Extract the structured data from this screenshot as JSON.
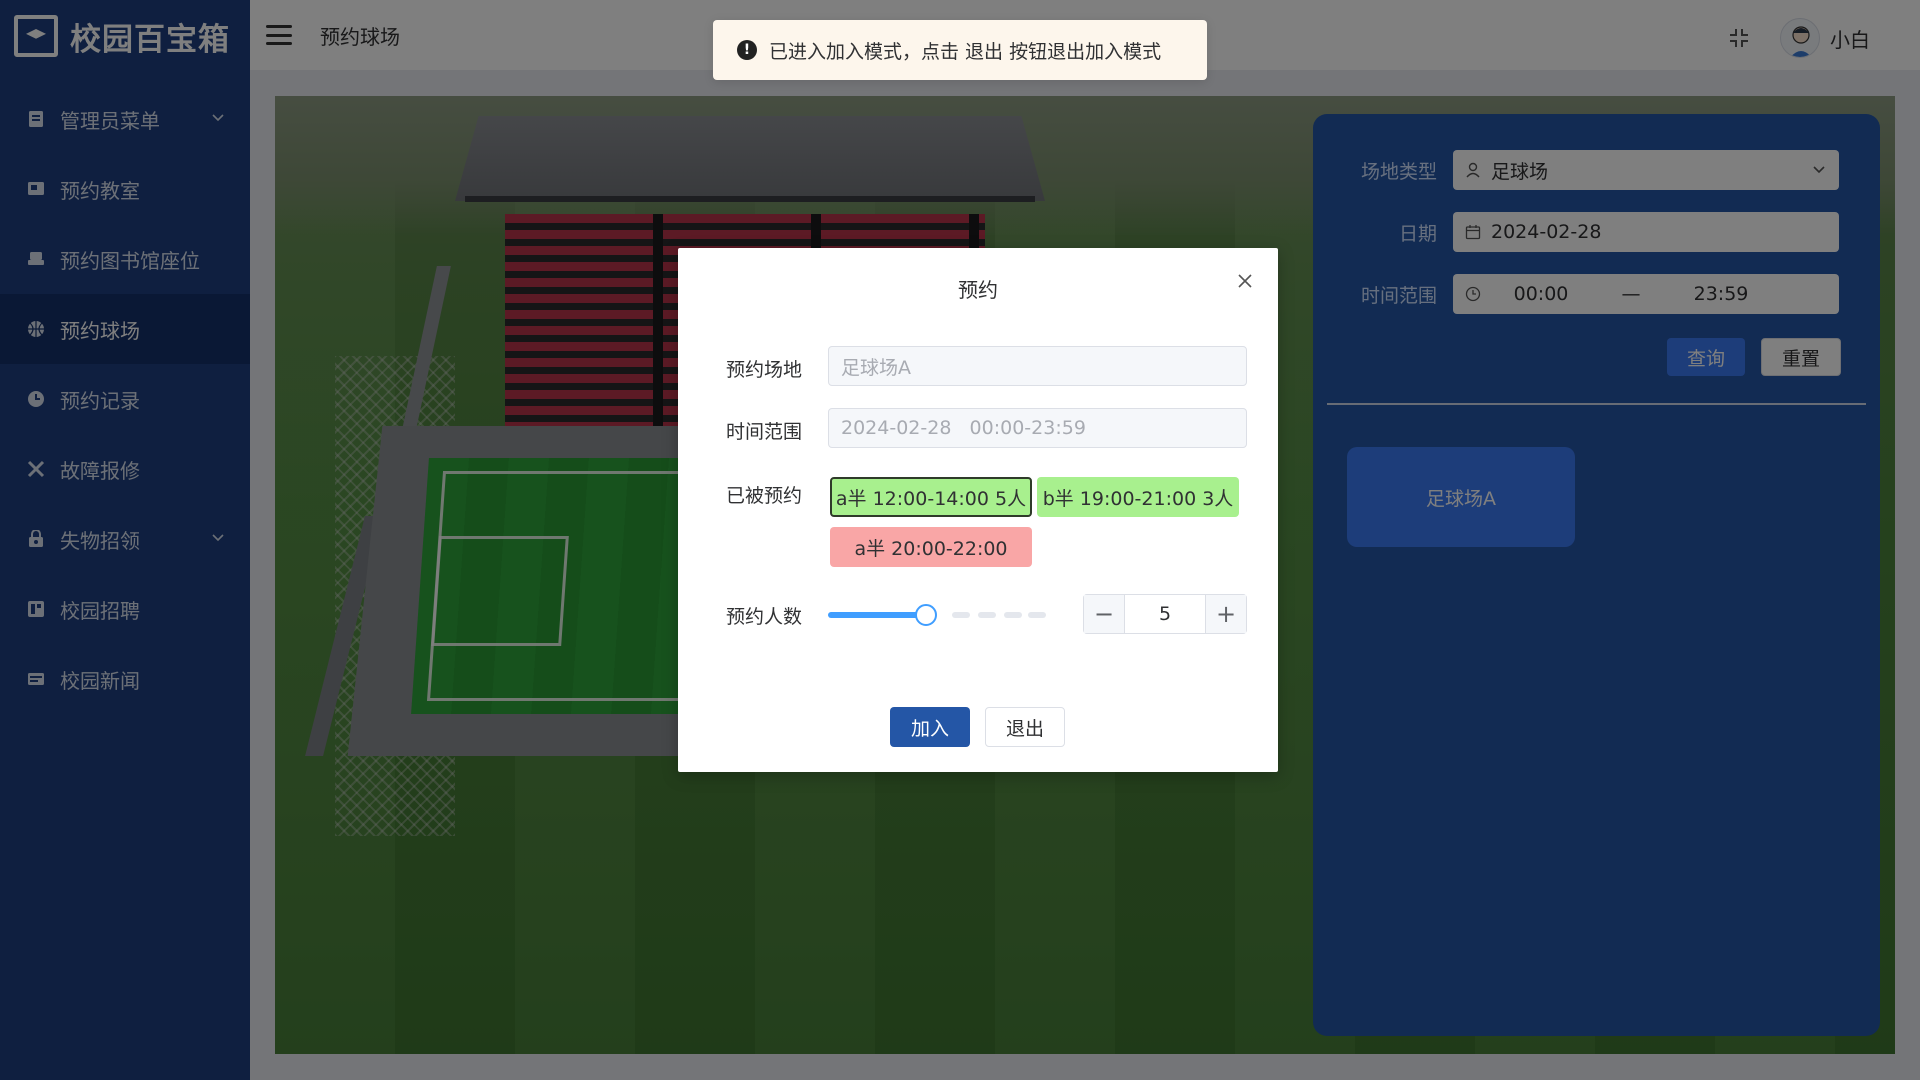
{
  "app": {
    "title": "校园百宝箱"
  },
  "sidebar": {
    "items": [
      {
        "label": "管理员菜单",
        "icon": "admin-doc-icon",
        "has_children": true
      },
      {
        "label": "预约教室",
        "icon": "classroom-icon",
        "has_children": false
      },
      {
        "label": "预约图书馆座位",
        "icon": "library-seat-icon",
        "has_children": false
      },
      {
        "label": "预约球场",
        "icon": "basketball-icon",
        "has_children": false,
        "active": true
      },
      {
        "label": "预约记录",
        "icon": "clock-icon",
        "has_children": false
      },
      {
        "label": "故障报修",
        "icon": "tools-icon",
        "has_children": false
      },
      {
        "label": "失物招领",
        "icon": "lock-bag-icon",
        "has_children": true
      },
      {
        "label": "校园招聘",
        "icon": "recruit-icon",
        "has_children": false
      },
      {
        "label": "校园新闻",
        "icon": "news-icon",
        "has_children": false
      }
    ]
  },
  "header": {
    "breadcrumb": "预约球场",
    "username": "小白"
  },
  "message": {
    "text": "已进入加入模式，点击 退出 按钮退出加入模式"
  },
  "filter_panel": {
    "type_label": "场地类型",
    "type_value": "足球场",
    "date_label": "日期",
    "date_value": "2024-02-28",
    "time_label": "时间范围",
    "time_start": "00:00",
    "time_sep": "—",
    "time_end": "23:59",
    "query_button": "查询",
    "reset_button": "重置",
    "venues": [
      "足球场A"
    ]
  },
  "dialog": {
    "title": "预约",
    "venue_label": "预约场地",
    "venue_value": "足球场A",
    "time_label": "时间范围",
    "time_value": "2024-02-28   00:00-23:59",
    "booked_label": "已被预约",
    "booked": [
      {
        "text": "a半 12:00-14:00 5人",
        "status": "green",
        "selected": true
      },
      {
        "text": "b半 19:00-21:00 3人",
        "status": "green",
        "selected": false
      },
      {
        "text": "a半 20:00-22:00",
        "status": "red",
        "selected": false
      }
    ],
    "count_label": "预约人数",
    "count_value": 5,
    "slider_fraction": 0.45,
    "join_button": "加入",
    "exit_button": "退出"
  },
  "colors": {
    "sidebar_bg": "#1e3f80",
    "sidebar_active": "#15306a",
    "primary": "#2456a6",
    "slider": "#409eff",
    "tag_green": "#a8f08e",
    "tag_red": "#f9a6a6"
  }
}
